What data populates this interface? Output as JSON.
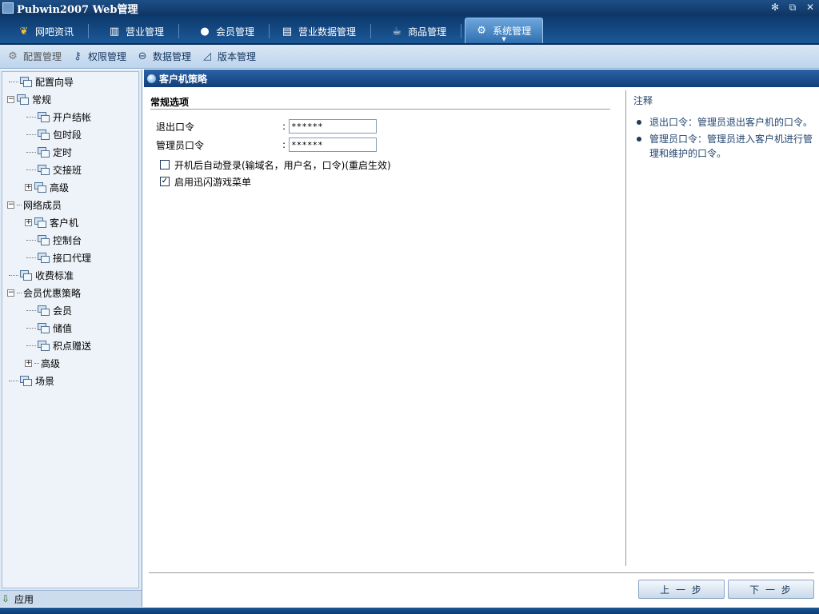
{
  "window": {
    "title": "Pubwin2007 Web管理"
  },
  "topnav": [
    {
      "label": "网吧资讯",
      "icon": "logo-icon"
    },
    {
      "label": "营业管理",
      "icon": "bar-chart-icon"
    },
    {
      "label": "会员管理",
      "icon": "user-icon"
    },
    {
      "label": "营业数据管理",
      "icon": "document-icon"
    },
    {
      "label": "商品管理",
      "icon": "cup-icon"
    },
    {
      "label": "系统管理",
      "icon": "gear-icon",
      "active": true
    }
  ],
  "subnav": [
    {
      "label": "配置管理",
      "icon": "gear-icon",
      "active": true
    },
    {
      "label": "权限管理",
      "icon": "key-icon"
    },
    {
      "label": "数据管理",
      "icon": "database-icon"
    },
    {
      "label": "版本管理",
      "icon": "version-icon"
    }
  ],
  "tree": {
    "wizard": "配置向导",
    "general": "常规",
    "opening_account": "开户结帐",
    "time_period": "包时段",
    "timed": "定时",
    "shift": "交接班",
    "advanced": "高级",
    "network": "网络成员",
    "client": "客户机",
    "console": "控制台",
    "proxy": "接口代理",
    "billing": "收费标准",
    "member_policy": "会员优惠策略",
    "member": "会员",
    "stored_value": "储值",
    "points": "积点赠送",
    "advanced2": "高级",
    "scene": "场景"
  },
  "sidebar_footer": {
    "label": "应用"
  },
  "panel": {
    "title": "客户机策略"
  },
  "section": {
    "title": "常规选项"
  },
  "form": {
    "exit_label": "退出口令",
    "exit_value": "******",
    "admin_label": "管理员口令",
    "admin_value": "******",
    "colon": ":",
    "autologin_label": "开机后自动登录(输域名，用户名，口令)(重启生效)",
    "autologin_checked": false,
    "gamemenu_label": "启用迅闪游戏菜单",
    "gamemenu_checked": true
  },
  "notes": {
    "title": "注释",
    "items": [
      "退出口令：管理员退出客户机的口令。",
      "管理员口令：管理员进入客户机进行管理和维护的口令。"
    ]
  },
  "buttons": {
    "prev": "上 一 步",
    "next": "下 一 步"
  },
  "colors": {
    "nav_bg": "#1b5898",
    "accent": "#2a62a6",
    "sidebar_bg": "#eef3f9"
  }
}
